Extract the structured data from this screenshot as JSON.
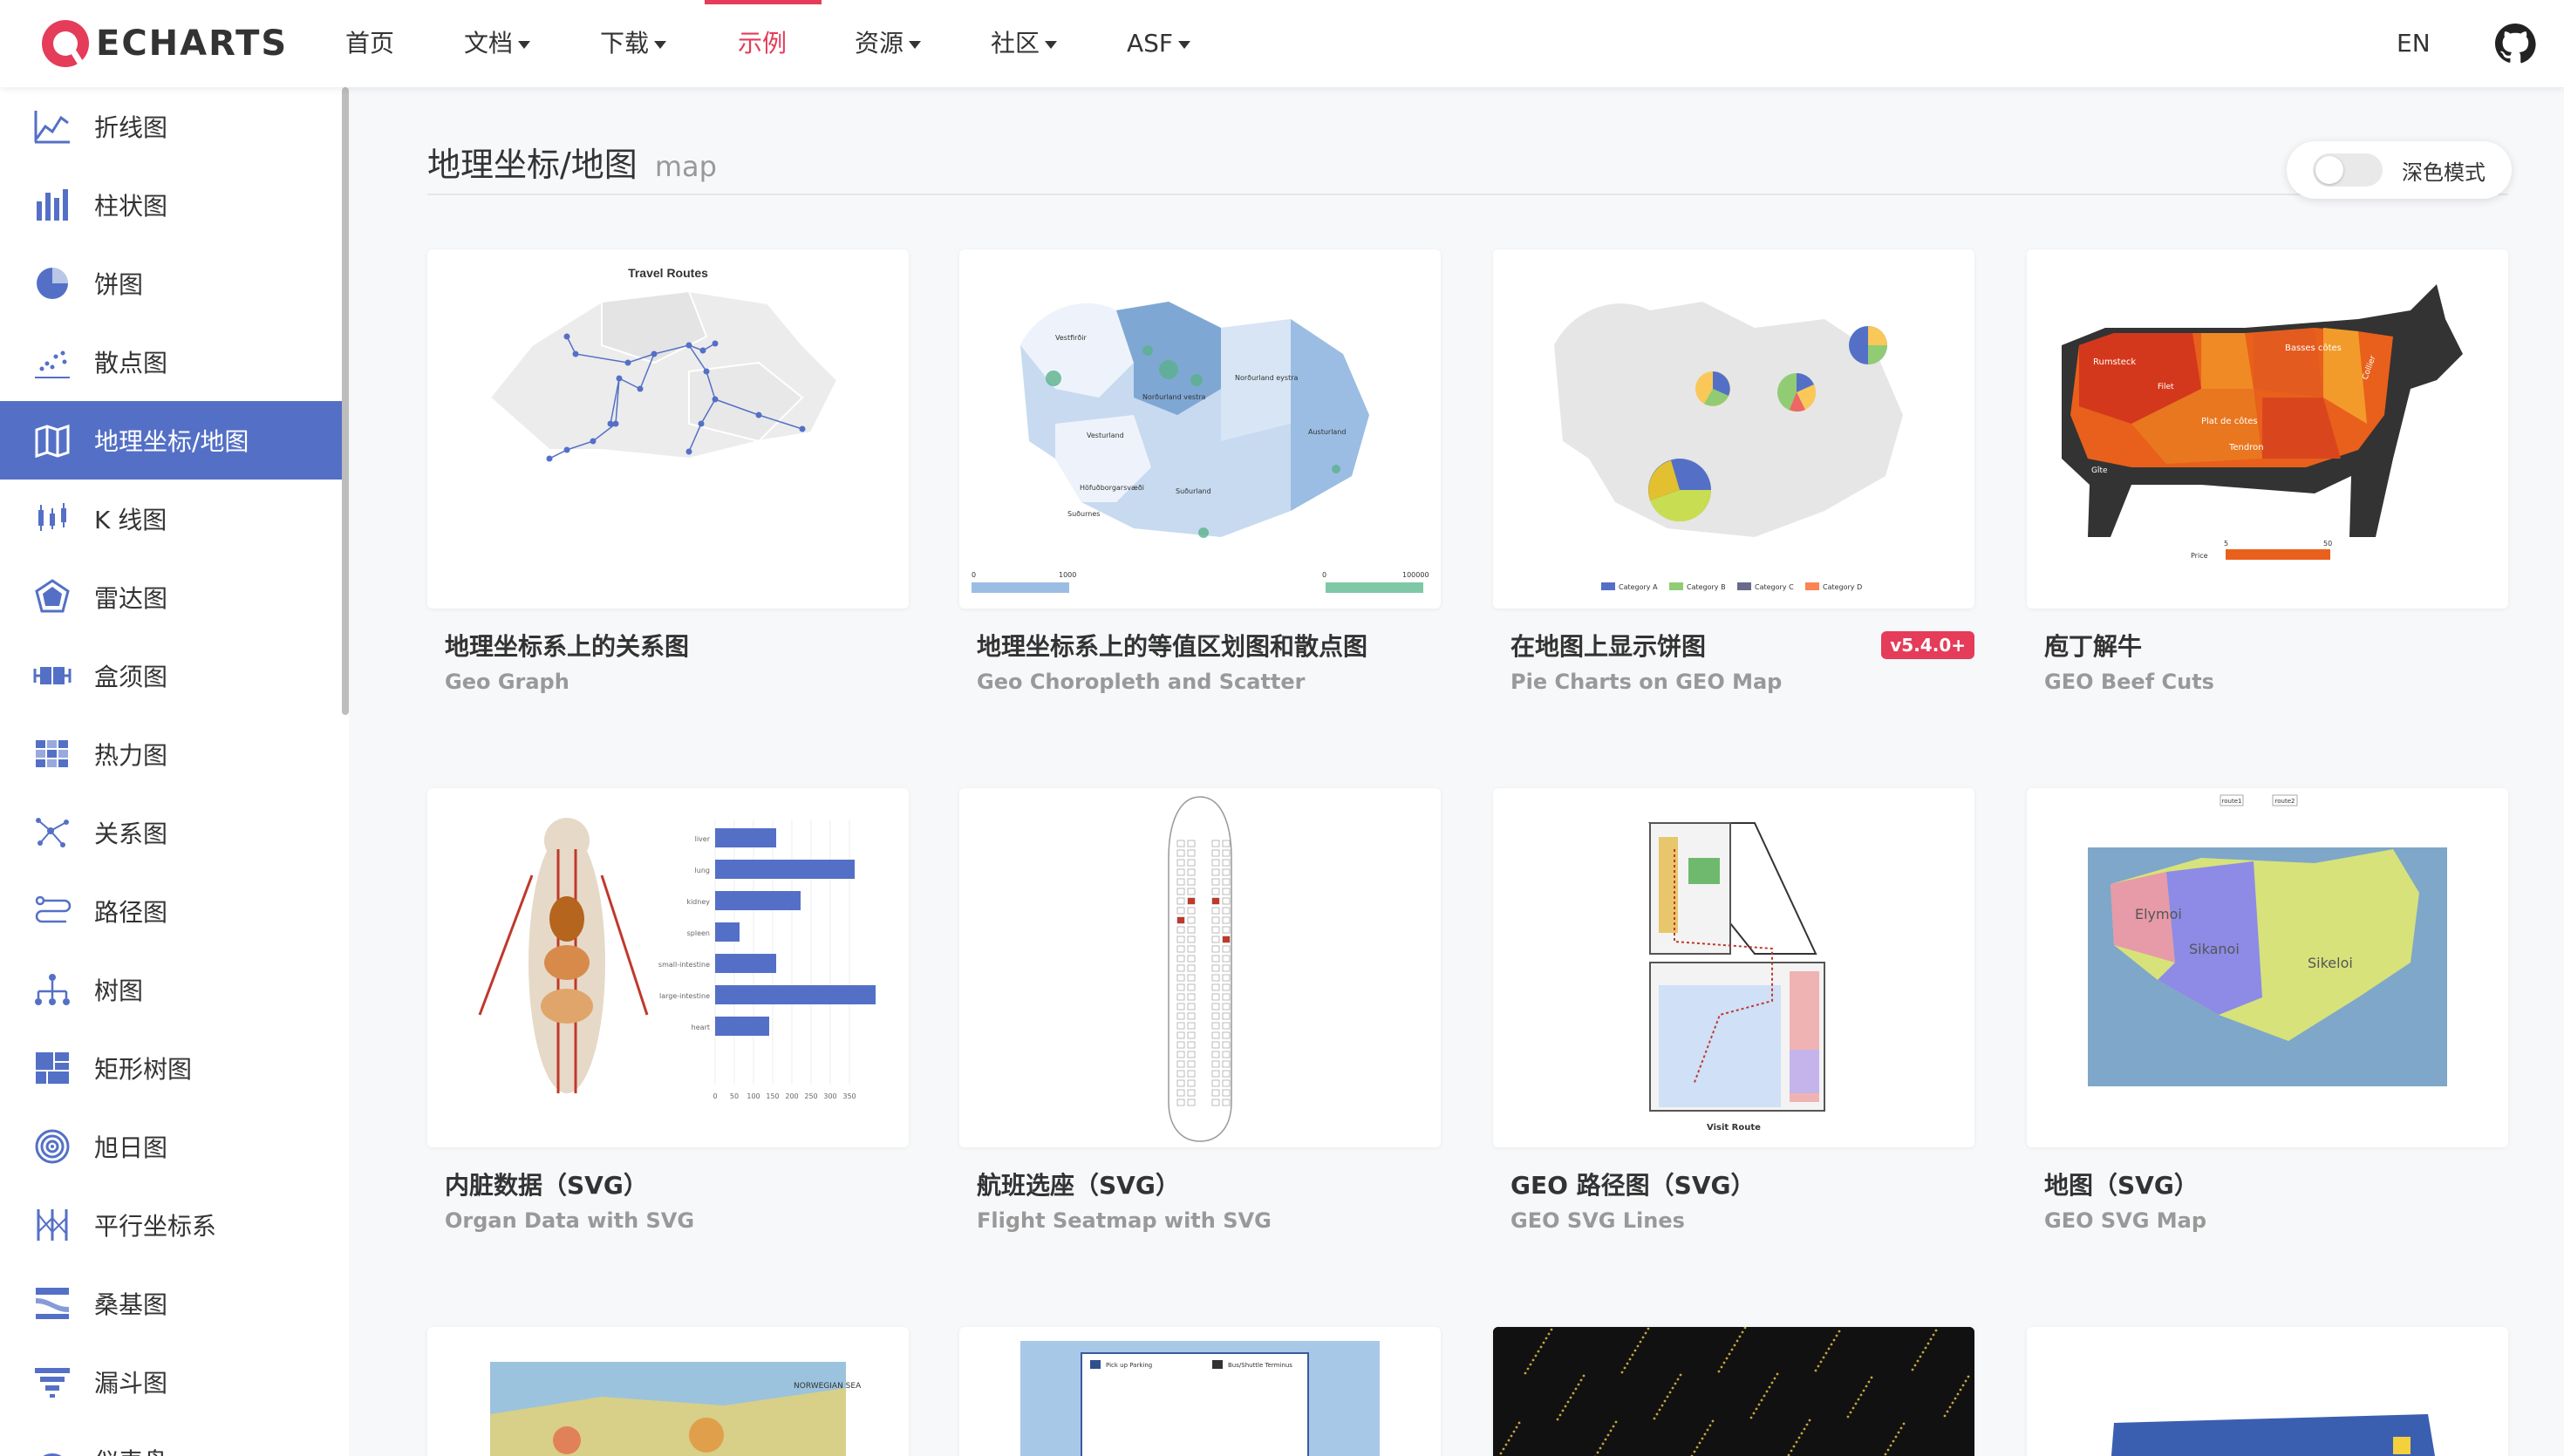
{
  "nav": {
    "logo_text": "ECHARTS",
    "items": [
      {
        "label": "首页",
        "dropdown": false
      },
      {
        "label": "文档",
        "dropdown": true
      },
      {
        "label": "下载",
        "dropdown": true
      },
      {
        "label": "示例",
        "dropdown": false,
        "active": true
      },
      {
        "label": "资源",
        "dropdown": true
      },
      {
        "label": "社区",
        "dropdown": true
      },
      {
        "label": "ASF",
        "dropdown": true
      }
    ],
    "lang": "EN",
    "github_icon": "github-icon",
    "active_color": "#e43c59"
  },
  "sidebar": {
    "accent": "#5470c6",
    "items": [
      {
        "label": "折线图",
        "icon": "line-chart-icon"
      },
      {
        "label": "柱状图",
        "icon": "bar-chart-icon"
      },
      {
        "label": "饼图",
        "icon": "pie-chart-icon"
      },
      {
        "label": "散点图",
        "icon": "scatter-chart-icon"
      },
      {
        "label": "地理坐标/地图",
        "icon": "map-icon",
        "active": true
      },
      {
        "label": "K 线图",
        "icon": "candlestick-icon"
      },
      {
        "label": "雷达图",
        "icon": "radar-icon"
      },
      {
        "label": "盒须图",
        "icon": "boxplot-icon"
      },
      {
        "label": "热力图",
        "icon": "heatmap-icon"
      },
      {
        "label": "关系图",
        "icon": "graph-icon"
      },
      {
        "label": "路径图",
        "icon": "lines-icon"
      },
      {
        "label": "树图",
        "icon": "tree-icon"
      },
      {
        "label": "矩形树图",
        "icon": "treemap-icon"
      },
      {
        "label": "旭日图",
        "icon": "sunburst-icon"
      },
      {
        "label": "平行坐标系",
        "icon": "parallel-icon"
      },
      {
        "label": "桑基图",
        "icon": "sankey-icon"
      },
      {
        "label": "漏斗图",
        "icon": "funnel-icon"
      },
      {
        "label": "仪表盘",
        "icon": "gauge-icon"
      }
    ]
  },
  "main": {
    "title": "地理坐标/地图",
    "subtitle": "map",
    "dark_mode_label": "深色模式",
    "cards": [
      {
        "title": "地理坐标系上的关系图",
        "subtitle": "Geo Graph",
        "thumb": "geo-graph",
        "thumb_text": [
          "Travel Routes"
        ]
      },
      {
        "title": "地理坐标系上的等值区划图和散点图",
        "subtitle": "Geo Choropleth and Scatter",
        "thumb": "geo-choropleth",
        "thumb_text": [
          "0",
          "1000",
          "0",
          "100000",
          "Vestfirðir",
          "Norðurland vestra",
          "Norðurland eystra",
          "Austurland",
          "Vesturland",
          "Suðurland",
          "Höfuðborgarsvæði",
          "Suðurnes"
        ]
      },
      {
        "title": "在地图上显示饼图",
        "subtitle": "Pie Charts on GEO Map",
        "badge": "v5.4.0+",
        "thumb": "geo-pie",
        "thumb_text": [
          "Category A",
          "Category B",
          "Category C",
          "Category D"
        ]
      },
      {
        "title": "庖丁解牛",
        "subtitle": "GEO Beef Cuts",
        "thumb": "beef",
        "thumb_text": [
          "Rumsteck",
          "Filet",
          "Basses côtes",
          "Collier",
          "Plat de côtes",
          "Tendron",
          "Gîte",
          "Price",
          "5",
          "50"
        ]
      },
      {
        "title": "内脏数据（SVG）",
        "subtitle": "Organ Data with SVG",
        "thumb": "organ",
        "thumb_text": [
          "liver",
          "lung",
          "kidney",
          "spleen",
          "small-intestine",
          "large-intestine",
          "heart",
          "0",
          "50",
          "100",
          "150",
          "200",
          "250",
          "300",
          "350"
        ]
      },
      {
        "title": "航班选座（SVG）",
        "subtitle": "Flight Seatmap with SVG",
        "thumb": "seat"
      },
      {
        "title": "GEO 路径图（SVG）",
        "subtitle": "GEO SVG Lines",
        "thumb": "svg-lines",
        "thumb_text": [
          "Visit Route"
        ]
      },
      {
        "title": "地图（SVG）",
        "subtitle": "GEO SVG Map",
        "thumb": "svg-map",
        "thumb_text": [
          "route1",
          "route2",
          "Elymoi",
          "Sikanoi",
          "Sikeloi"
        ]
      },
      {
        "thumb": "heat-map-partial",
        "thumb_text": [
          "NORWEGIAN SEA"
        ]
      },
      {
        "thumb": "parking-partial",
        "thumb_text": [
          "Pick up Parking",
          "Bus/Shuttle Terminus"
        ]
      },
      {
        "thumb": "lights-partial"
      },
      {
        "thumb": "usa-partial"
      }
    ]
  }
}
